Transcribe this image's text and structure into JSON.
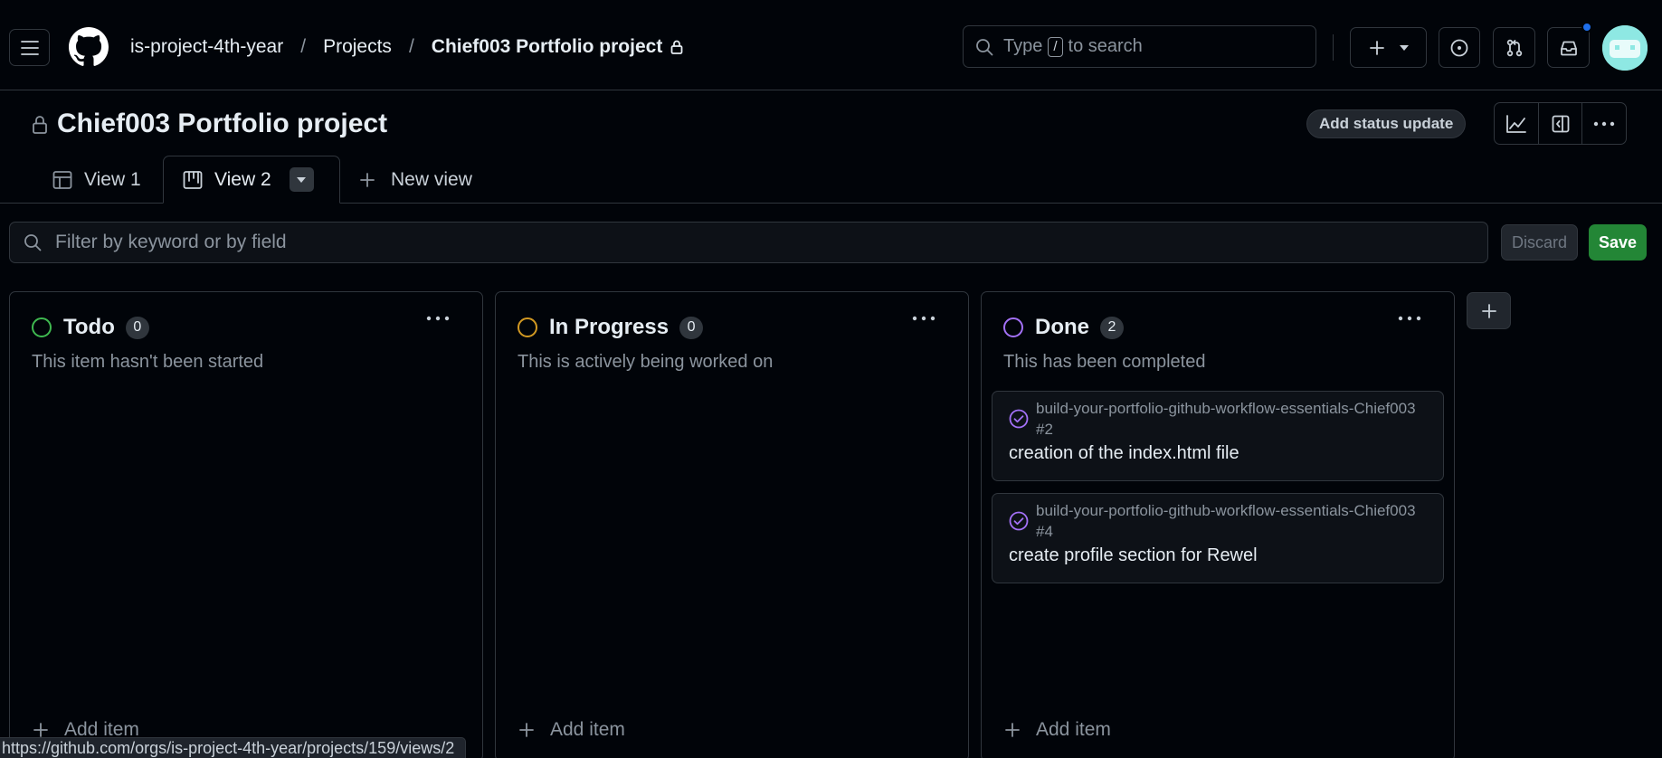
{
  "header": {
    "breadcrumbs": [
      {
        "label": "is-project-4th-year"
      },
      {
        "label": "Projects"
      },
      {
        "label": "Chief003 Portfolio project"
      }
    ],
    "search": {
      "prefix": "Type",
      "kbd": "/",
      "suffix": "to search"
    },
    "icons": [
      "hamburger-icon",
      "github-logo-icon",
      "lock-icon",
      "search-icon",
      "plus-icon",
      "chevron-down-icon",
      "issue-icon",
      "pull-request-icon",
      "inbox-icon",
      "avatar"
    ],
    "notification_dot_color": "#1f6feb"
  },
  "project": {
    "title": "Chief003 Portfolio project",
    "status_button": "Add status update"
  },
  "tabs": [
    {
      "label": "View 1",
      "icon": "table-icon",
      "active": false
    },
    {
      "label": "View 2",
      "icon": "board-icon",
      "active": true
    },
    {
      "label": "New view",
      "icon": "plus-icon",
      "active": false
    }
  ],
  "filter": {
    "placeholder": "Filter by keyword or by field",
    "discard_label": "Discard",
    "save_label": "Save"
  },
  "columns": [
    {
      "title": "Todo",
      "count": "0",
      "description": "This item hasn't been started",
      "color": "#3fb950",
      "add_label": "Add item",
      "cards": []
    },
    {
      "title": "In Progress",
      "count": "0",
      "description": "This is actively being worked on",
      "color": "#d29922",
      "add_label": "Add item",
      "cards": []
    },
    {
      "title": "Done",
      "count": "2",
      "description": "This has been completed",
      "color": "#a371f7",
      "add_label": "Add item",
      "cards": [
        {
          "repo": "build-your-portfolio-github-workflow-essentials-Chief003 #2",
          "title": "creation of the index.html file"
        },
        {
          "repo": "build-your-portfolio-github-workflow-essentials-Chief003 #4",
          "title": "create profile section for Rewel"
        }
      ]
    }
  ],
  "status_bar_url": "https://github.com/orgs/is-project-4th-year/projects/159/views/2",
  "colors": {
    "background": "#010409",
    "border": "#30363d",
    "save_green": "#238636",
    "done_purple": "#a371f7"
  }
}
